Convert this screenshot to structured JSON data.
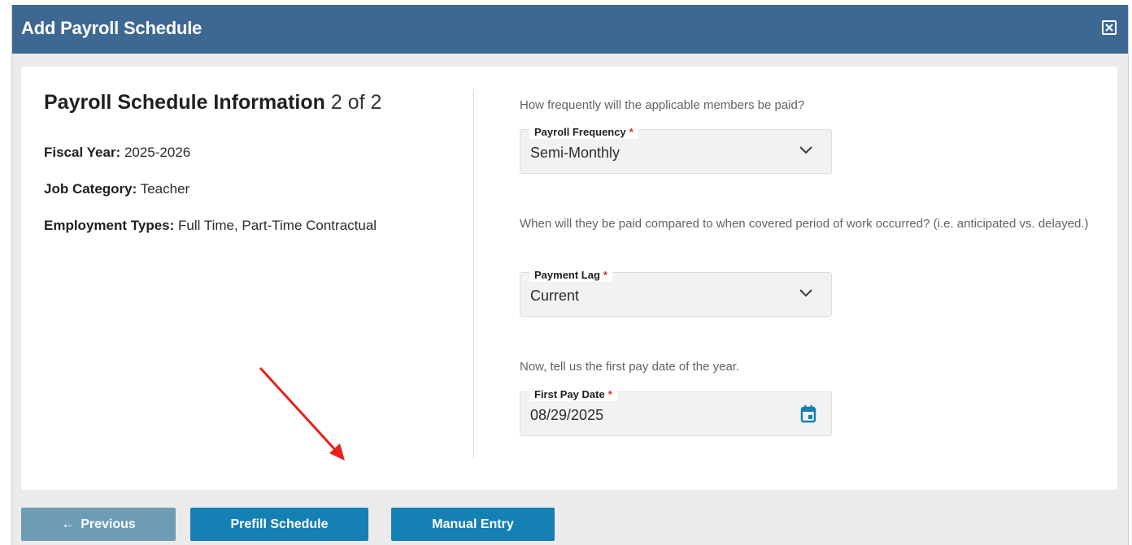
{
  "modal": {
    "title": "Add Payroll Schedule"
  },
  "summary": {
    "heading": "Payroll Schedule Information",
    "step": "2 of 2",
    "fiscal_year_label": "Fiscal Year:",
    "fiscal_year_value": "2025-2026",
    "job_category_label": "Job Category:",
    "job_category_value": "Teacher",
    "employment_types_label": "Employment Types:",
    "employment_types_value": "Full Time, Part-Time Contractual"
  },
  "form": {
    "frequency_question": "How frequently will the applicable members be paid?",
    "frequency_label": "Payroll Frequency",
    "frequency_value": "Semi-Monthly",
    "lag_question": "When will they be paid compared to when covered period of work occurred? (i.e. anticipated vs. delayed.)",
    "lag_label": "Payment Lag",
    "lag_value": "Current",
    "pay_date_question": "Now, tell us the first pay date of the year.",
    "pay_date_label": "First Pay Date",
    "pay_date_value": "08/29/2025",
    "required_marker": "*"
  },
  "footer": {
    "previous_arrow": "←",
    "previous_label": "Previous",
    "prefill_label": "Prefill Schedule",
    "manual_label": "Manual Entry"
  },
  "colors": {
    "header_bg": "#3d6891",
    "primary_button": "#1480b3",
    "disabled_button": "#6e9cb5",
    "required": "#d32f2f",
    "calendar_icon": "#1480b3",
    "annotation_arrow": "#e8201c"
  },
  "icons": {
    "close": "close-icon",
    "dropdown": "chevron-down-icon",
    "calendar": "calendar-icon",
    "annotation": "red-arrow-annotation"
  }
}
